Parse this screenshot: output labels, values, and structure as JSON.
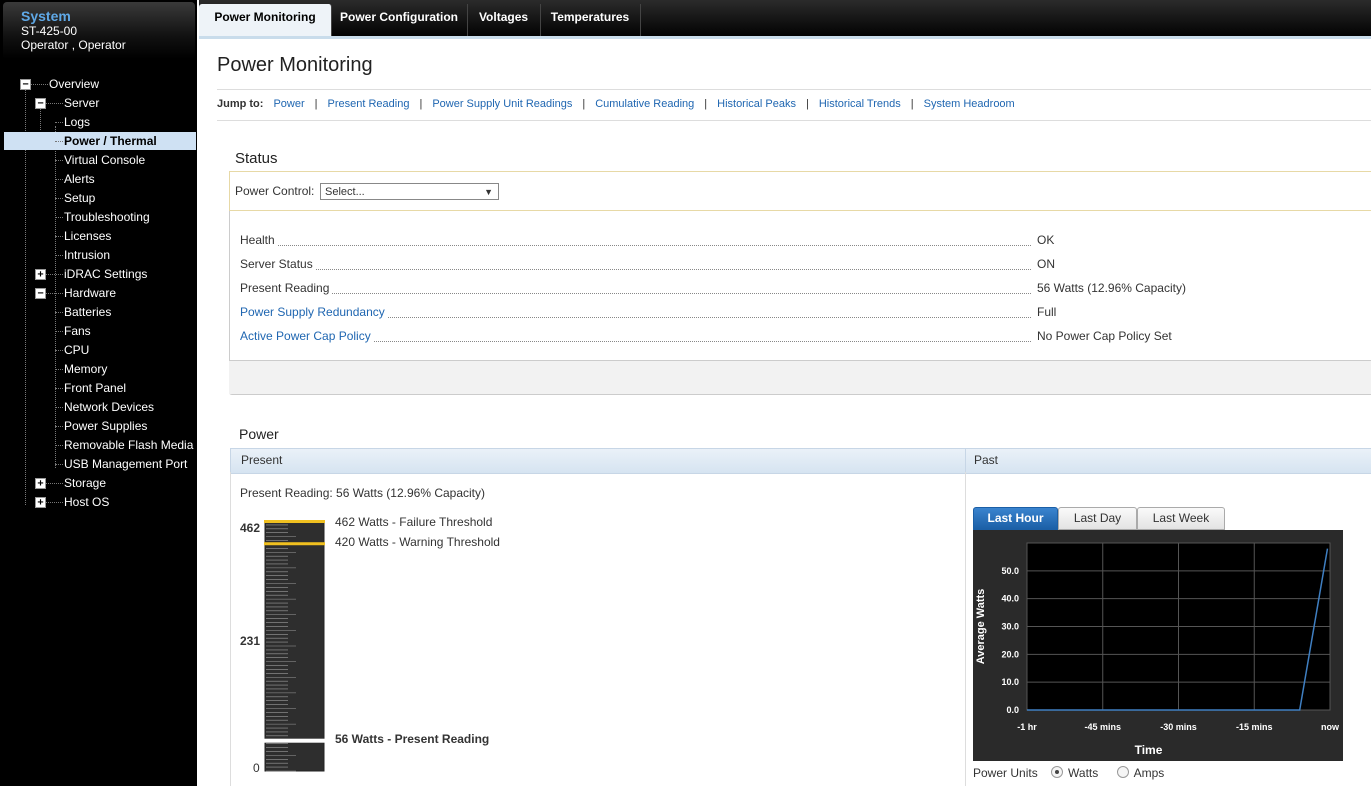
{
  "sidebar": {
    "system_title": "System",
    "model": "ST-425-00",
    "user": "Operator , Operator",
    "items": [
      {
        "label": "Overview"
      },
      {
        "label": "Server"
      },
      {
        "label": "Logs"
      },
      {
        "label": "Power / Thermal"
      },
      {
        "label": "Virtual Console"
      },
      {
        "label": "Alerts"
      },
      {
        "label": "Setup"
      },
      {
        "label": "Troubleshooting"
      },
      {
        "label": "Licenses"
      },
      {
        "label": "Intrusion"
      },
      {
        "label": "iDRAC Settings"
      },
      {
        "label": "Hardware"
      },
      {
        "label": "Batteries"
      },
      {
        "label": "Fans"
      },
      {
        "label": "CPU"
      },
      {
        "label": "Memory"
      },
      {
        "label": "Front Panel"
      },
      {
        "label": "Network Devices"
      },
      {
        "label": "Power Supplies"
      },
      {
        "label": "Removable Flash Media"
      },
      {
        "label": "USB Management Port"
      },
      {
        "label": "Storage"
      },
      {
        "label": "Host OS"
      }
    ],
    "toggle_minus": "−",
    "toggle_plus": "+"
  },
  "tabs": [
    {
      "label": "Power Monitoring"
    },
    {
      "label": "Power Configuration"
    },
    {
      "label": "Voltages"
    },
    {
      "label": "Temperatures"
    }
  ],
  "page": {
    "title": "Power Monitoring",
    "jump_label": "Jump to:",
    "jump_links": [
      "Power",
      "Present Reading",
      "Power Supply Unit Readings",
      "Cumulative Reading",
      "Historical Peaks",
      "Historical Trends",
      "System Headroom"
    ],
    "jump_sep": "|"
  },
  "status": {
    "title": "Status",
    "power_control_label": "Power Control:",
    "power_control_value": "Select...",
    "rows": [
      {
        "key": "Health",
        "value": "OK"
      },
      {
        "key": "Server Status",
        "value": "ON"
      },
      {
        "key": "Present Reading",
        "value": "56 Watts (12.96% Capacity)"
      },
      {
        "key": "Power Supply Redundancy",
        "value": "Full"
      },
      {
        "key": "Active Power Cap Policy",
        "value": "No Power Cap Policy Set"
      }
    ]
  },
  "power": {
    "title": "Power",
    "present_header": "Present",
    "past_header": "Past",
    "present_reading": "Present Reading: 56 Watts (12.96% Capacity)",
    "gauge": {
      "max_label": "462",
      "mid_label": "231",
      "min_label": "0",
      "max": 462,
      "warning": 420,
      "failure": 462,
      "present": 56,
      "failure_note": "462 Watts - Failure Threshold",
      "warning_note": "420 Watts - Warning Threshold",
      "present_note": "56 Watts - Present Reading",
      "marker_color": "#f0c020"
    },
    "past_tabs": [
      "Last Hour",
      "Last Day",
      "Last Week"
    ],
    "units_label": "Power Units",
    "units": [
      "Watts",
      "Amps"
    ]
  },
  "chart_data": {
    "type": "line",
    "title": "",
    "xlabel": "Time",
    "ylabel": "Average Watts",
    "x_ticks": [
      "-1 hr",
      "-45 mins",
      "-30 mins",
      "-15 mins",
      "now"
    ],
    "y_ticks": [
      "0.0",
      "10.0",
      "20.0",
      "30.0",
      "40.0",
      "50.0"
    ],
    "ylim": [
      0,
      60
    ],
    "xlim_minutes": [
      -60,
      0
    ],
    "series": [
      {
        "points": [
          [
            -60,
            0
          ],
          [
            -55,
            0
          ],
          [
            -50,
            0
          ],
          [
            -45,
            0
          ],
          [
            -40,
            0
          ],
          [
            -35,
            0
          ],
          [
            -30,
            0
          ],
          [
            -25,
            0
          ],
          [
            -20,
            0
          ],
          [
            -15,
            0
          ],
          [
            -10,
            0
          ],
          [
            -6,
            0
          ],
          [
            -0.5,
            58
          ]
        ]
      }
    ],
    "colors": {
      "background": "#2a2a2a",
      "grid": "#555555",
      "line": "#3f7fc2",
      "text": "#ffffff"
    },
    "grid": true
  }
}
